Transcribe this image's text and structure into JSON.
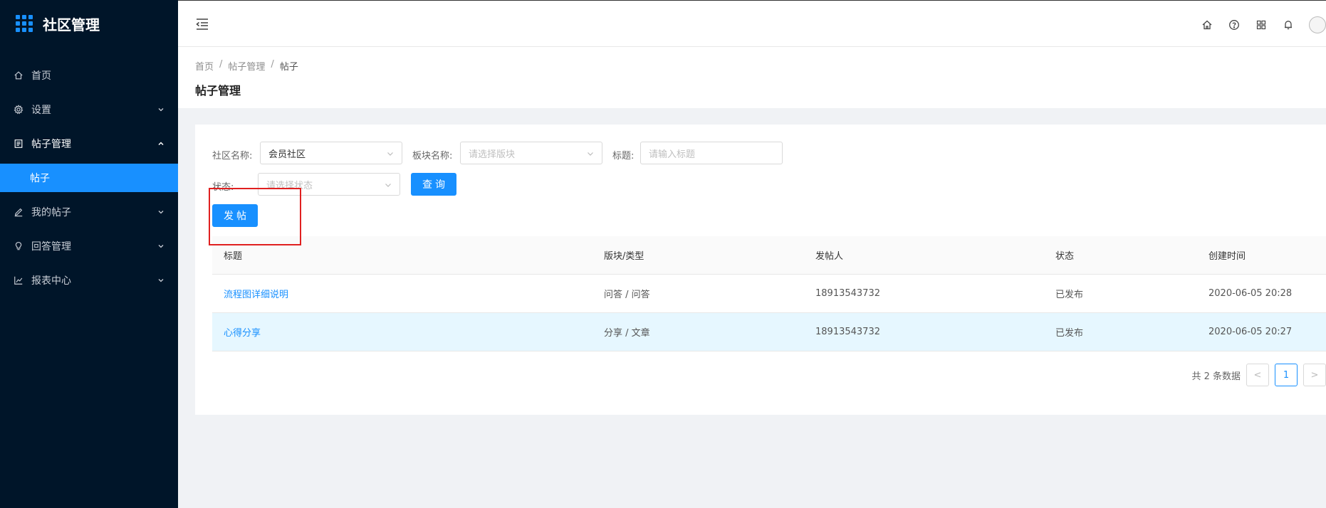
{
  "app": {
    "title": "社区管理"
  },
  "sidebar": {
    "items": [
      {
        "label": "首页",
        "icon": "home-icon"
      },
      {
        "label": "设置",
        "icon": "gear-icon"
      },
      {
        "label": "帖子管理",
        "icon": "document-icon",
        "open": true
      },
      {
        "label": "我的帖子",
        "icon": "edit-icon"
      },
      {
        "label": "回答管理",
        "icon": "bulb-icon"
      },
      {
        "label": "报表中心",
        "icon": "chart-icon"
      }
    ],
    "active_sub": "帖子"
  },
  "breadcrumb": [
    "首页",
    "帖子管理",
    "帖子"
  ],
  "page": {
    "title": "帖子管理"
  },
  "filters": {
    "community_label": "社区名称:",
    "community_value": "会员社区",
    "section_label": "板块名称:",
    "section_placeholder": "请选择版块",
    "title_label": "标题:",
    "title_placeholder": "请输入标题",
    "status_label": "状态:",
    "status_placeholder": "请选择状态",
    "query_button": "查询"
  },
  "toolbar": {
    "post_button": "发帖"
  },
  "table": {
    "columns": [
      "标题",
      "版块/类型",
      "发帖人",
      "状态",
      "创建时间"
    ],
    "rows": [
      {
        "title": "流程图详细说明",
        "section": "问答 / 问答",
        "author": "18913543732",
        "status": "已发布",
        "created": "2020-06-05 20:28"
      },
      {
        "title": "心得分享",
        "section": "分享 / 文章",
        "author": "18913543732",
        "status": "已发布",
        "created": "2020-06-05 20:27"
      }
    ]
  },
  "pagination": {
    "total_text": "共 2 条数据",
    "current": "1",
    "prev": "<",
    "next": ">"
  },
  "colors": {
    "sidebar_bg": "#001529",
    "primary": "#1890ff",
    "highlight": "#e02020"
  }
}
